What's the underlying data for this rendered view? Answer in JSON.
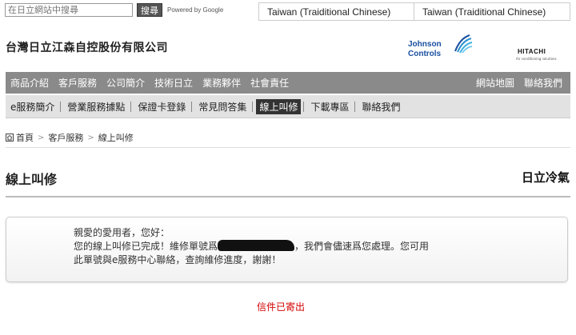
{
  "search": {
    "placeholder": "在日立網站中搜尋",
    "button_label": "搜尋",
    "powered_by": "Powered by Google"
  },
  "languages": [
    "Taiwan (Traiditional Chinese)",
    "Taiwan (Traiditional Chinese)"
  ],
  "header": {
    "company_name": "台灣日立江森自控股份有限公司",
    "jci_line1": "Johnson",
    "jci_line2": "Controls",
    "hitachi": "HITACHI",
    "hitachi_sub": "Air conditioning solutions"
  },
  "main_nav": {
    "left": [
      "商品介紹",
      "客戶服務",
      "公司簡介",
      "技術日立",
      "業務夥伴",
      "社會責任"
    ],
    "right": [
      "網站地圖",
      "聯絡我們"
    ]
  },
  "sub_nav": {
    "items": [
      "e服務簡介",
      "營業服務據點",
      "保證卡登錄",
      "常見問答集",
      "線上叫修",
      "下載專區",
      "聯絡我們"
    ],
    "active_index": 4
  },
  "breadcrumb": [
    "首頁",
    "客戶服務",
    "線上叫修"
  ],
  "page_title": "線上叫修",
  "brand_right": "日立冷氣",
  "message": {
    "line1": "親愛的愛用者，您好：",
    "line2_pre": "您的線上叫修已完成！維修單號爲",
    "line2_post": "，我們會儘速爲您處理。您可用",
    "line3": "此單號與e服務中心聯絡，查詢維修進度，謝謝！"
  },
  "sent_notice": "信件已寄出",
  "colors": {
    "nav_bg": "#8a8a8a",
    "subnav_bg": "#e2e2e2",
    "accent_red": "#d40000",
    "jci_blue": "#1a4fa0"
  }
}
